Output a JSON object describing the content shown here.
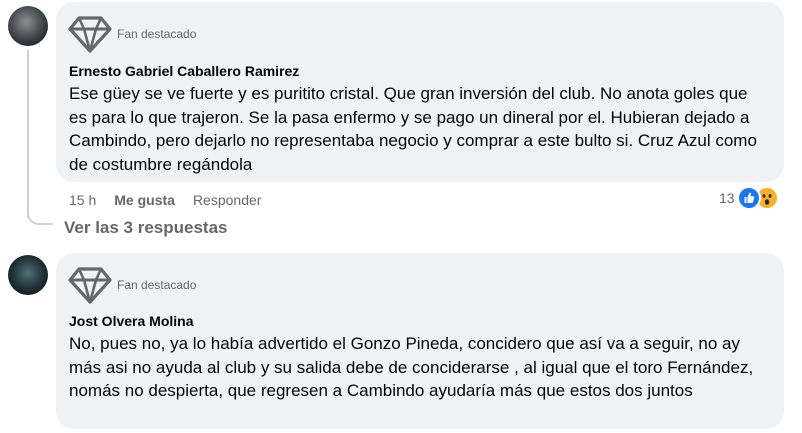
{
  "comments": [
    {
      "badge": "Fan destacado",
      "author": "Ernesto Gabriel Caballero Ramirez",
      "text": "Ese güey se ve fuerte y es puritito cristal. Que gran inversión del club. No anota goles que es para lo que trajeron. Se la pasa enfermo y se pago un dineral por el. Hubieran dejado a Cambindo, pero dejarlo no representaba negocio y comprar a este bulto si. Cruz Azul como de costumbre regándola",
      "time": "15 h",
      "like_label": "Me gusta",
      "reply_label": "Responder",
      "reaction_count": "13",
      "reactions": [
        "like-icon",
        "wow-icon"
      ],
      "view_replies": "Ver las 3 respuestas"
    },
    {
      "badge": "Fan destacado",
      "author": "Jost Olvera Molina",
      "text": "No, pues no, ya lo había advertido el Gonzo Pineda, concidero que así va a seguir, no ay más asi no ayuda al club y su salida debe de conciderarse , al igual que el toro Fernández, nomás no despierta, que regresen a Cambindo ayudaría más que estos dos juntos"
    }
  ],
  "colors": {
    "bubble": "#f0f2f5",
    "secondary_text": "#65676b",
    "like_blue": "#1877f2",
    "wow_yellow": "#f7b125"
  }
}
